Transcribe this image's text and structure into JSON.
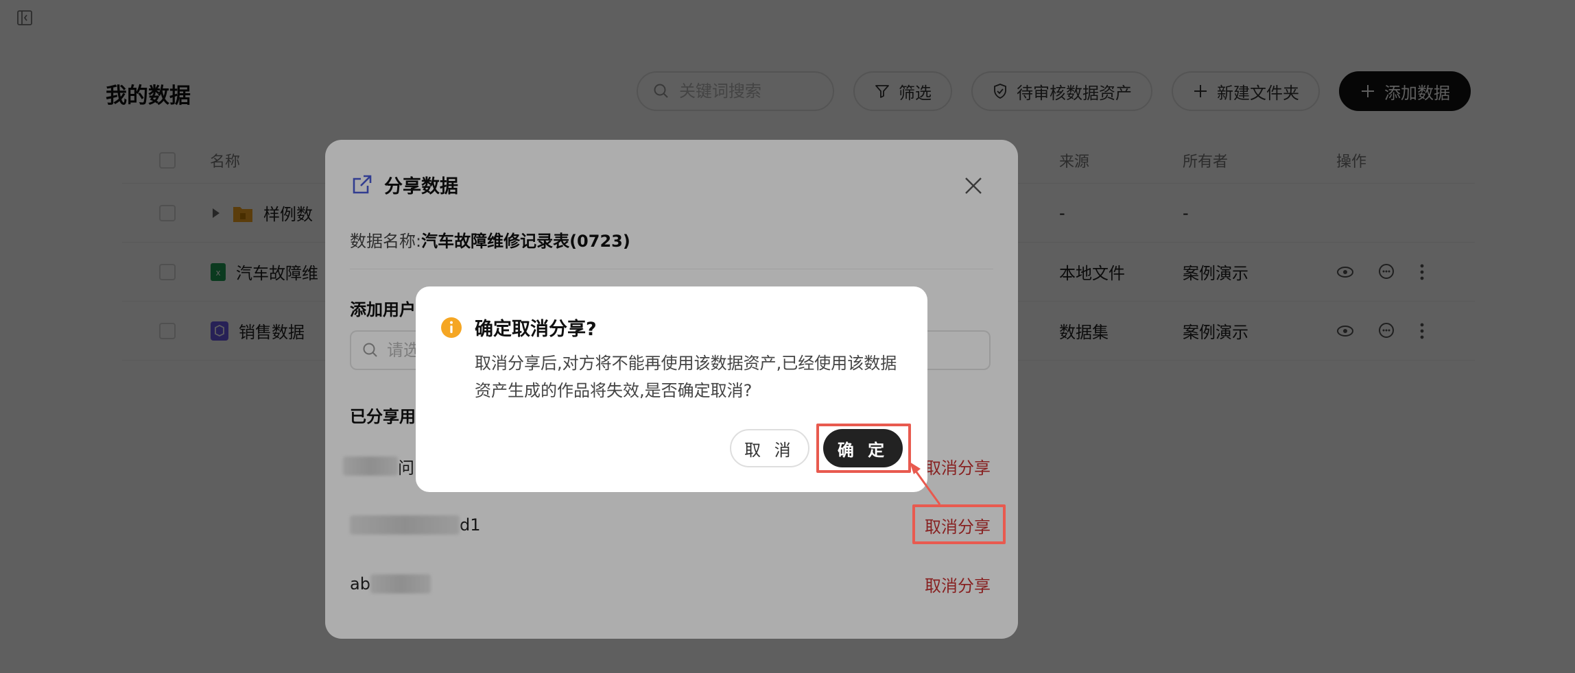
{
  "page": {
    "title": "我的数据",
    "search_placeholder": "关键词搜索",
    "filter_label": "筛选",
    "pending_label": "待审核数据资产",
    "new_folder_label": "新建文件夹",
    "add_data_label": "添加数据"
  },
  "table": {
    "headers": {
      "name": "名称",
      "source": "来源",
      "owner": "所有者",
      "actions": "操作"
    },
    "rows": [
      {
        "name": "样例数",
        "source": "-",
        "owner": "-",
        "icon": "folder-icon"
      },
      {
        "name": "汽车故障维",
        "source": "本地文件",
        "owner": "案例演示",
        "icon": "excel-icon"
      },
      {
        "name": "销售数据",
        "source": "数据集",
        "owner": "案例演示",
        "icon": "dataset-icon"
      }
    ]
  },
  "share_modal": {
    "title": "分享数据",
    "data_name_label": "数据名称:",
    "data_name_value": "汽车故障维修记录表(0723)",
    "add_user_label": "添加用户",
    "user_search_placeholder": "请选",
    "shared_users_label": "已分享用",
    "shared_users": [
      {
        "visible_text": "问",
        "revoke_label": "取消分享"
      },
      {
        "visible_text": "d1",
        "revoke_label": "取消分享"
      },
      {
        "visible_text": "ab",
        "revoke_label": "取消分享"
      }
    ]
  },
  "confirm_dialog": {
    "title": "确定取消分享?",
    "body": "取消分享后,对方将不能再使用该数据资产,已经使用该数据资产生成的作品将失效,是否确定取消?",
    "cancel_label": "取 消",
    "ok_label": "确 定"
  },
  "colors": {
    "primary_button": "#111111",
    "revoke_link": "#c83232",
    "warning_icon": "#f5a623",
    "annotation": "#e85a4f",
    "share_icon": "#4a5bd4"
  }
}
